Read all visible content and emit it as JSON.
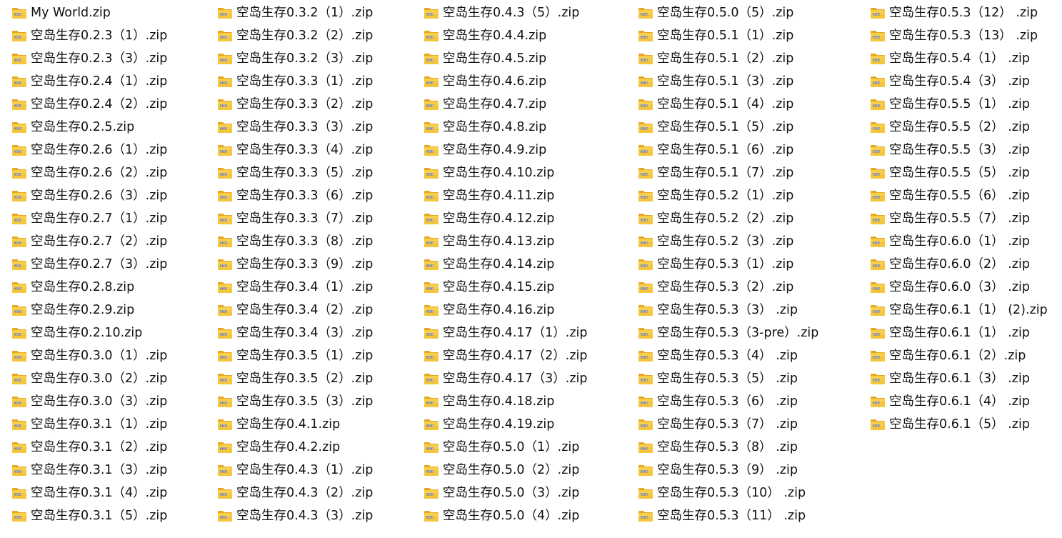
{
  "window": {
    "view": "icons-list",
    "icon": "zip-folder-icon"
  },
  "columns": [
    {
      "id": "col-1",
      "files": [
        "My World.zip",
        "空岛生存0.2.3（1）.zip",
        "空岛生存0.2.3（3）.zip",
        "空岛生存0.2.4（1）.zip",
        "空岛生存0.2.4（2）.zip",
        "空岛生存0.2.5.zip",
        "空岛生存0.2.6（1）.zip",
        "空岛生存0.2.6（2）.zip",
        "空岛生存0.2.6（3）.zip",
        "空岛生存0.2.7（1）.zip",
        "空岛生存0.2.7（2）.zip",
        "空岛生存0.2.7（3）.zip",
        "空岛生存0.2.8.zip",
        "空岛生存0.2.9.zip",
        "空岛生存0.2.10.zip",
        "空岛生存0.3.0（1）.zip",
        "空岛生存0.3.0（2）.zip",
        "空岛生存0.3.0（3）.zip",
        "空岛生存0.3.1（1）.zip",
        "空岛生存0.3.1（2）.zip",
        "空岛生存0.3.1（3）.zip",
        "空岛生存0.3.1（4）.zip",
        "空岛生存0.3.1（5）.zip"
      ]
    },
    {
      "id": "col-2",
      "files": [
        "空岛生存0.3.2（1）.zip",
        "空岛生存0.3.2（2）.zip",
        "空岛生存0.3.2（3）.zip",
        "空岛生存0.3.3（1）.zip",
        "空岛生存0.3.3（2）.zip",
        "空岛生存0.3.3（3）.zip",
        "空岛生存0.3.3（4）.zip",
        "空岛生存0.3.3（5）.zip",
        "空岛生存0.3.3（6）.zip",
        "空岛生存0.3.3（7）.zip",
        "空岛生存0.3.3（8）.zip",
        "空岛生存0.3.3（9）.zip",
        "空岛生存0.3.4（1）.zip",
        "空岛生存0.3.4（2）.zip",
        "空岛生存0.3.4（3）.zip",
        "空岛生存0.3.5（1）.zip",
        "空岛生存0.3.5（2）.zip",
        "空岛生存0.3.5（3）.zip",
        "空岛生存0.4.1.zip",
        "空岛生存0.4.2.zip",
        "空岛生存0.4.3（1）.zip",
        "空岛生存0.4.3（2）.zip",
        "空岛生存0.4.3（3）.zip"
      ]
    },
    {
      "id": "col-3",
      "files": [
        "空岛生存0.4.3（5）.zip",
        "空岛生存0.4.4.zip",
        "空岛生存0.4.5.zip",
        "空岛生存0.4.6.zip",
        "空岛生存0.4.7.zip",
        "空岛生存0.4.8.zip",
        "空岛生存0.4.9.zip",
        "空岛生存0.4.10.zip",
        "空岛生存0.4.11.zip",
        "空岛生存0.4.12.zip",
        "空岛生存0.4.13.zip",
        "空岛生存0.4.14.zip",
        "空岛生存0.4.15.zip",
        "空岛生存0.4.16.zip",
        "空岛生存0.4.17（1）.zip",
        "空岛生存0.4.17（2）.zip",
        "空岛生存0.4.17（3）.zip",
        "空岛生存0.4.18.zip",
        "空岛生存0.4.19.zip",
        "空岛生存0.5.0（1）.zip",
        "空岛生存0.5.0（2）.zip",
        "空岛生存0.5.0（3）.zip",
        "空岛生存0.5.0（4）.zip"
      ]
    },
    {
      "id": "col-4",
      "files": [
        "空岛生存0.5.0（5）.zip",
        "空岛生存0.5.1（1）.zip",
        "空岛生存0.5.1（2）.zip",
        "空岛生存0.5.1（3）.zip",
        "空岛生存0.5.1（4）.zip",
        "空岛生存0.5.1（5）.zip",
        "空岛生存0.5.1（6）.zip",
        "空岛生存0.5.1（7）.zip",
        "空岛生存0.5.2（1）.zip",
        "空岛生存0.5.2（2）.zip",
        "空岛生存0.5.2（3）.zip",
        "空岛生存0.5.3（1）.zip",
        "空岛生存0.5.3（2）.zip",
        "空岛生存0.5.3（3） .zip",
        "空岛生存0.5.3（3-pre）.zip",
        "空岛生存0.5.3（4） .zip",
        "空岛生存0.5.3（5） .zip",
        "空岛生存0.5.3（6） .zip",
        "空岛生存0.5.3（7） .zip",
        "空岛生存0.5.3（8） .zip",
        "空岛生存0.5.3（9） .zip",
        "空岛生存0.5.3（10） .zip",
        "空岛生存0.5.3（11） .zip"
      ]
    },
    {
      "id": "col-5",
      "files": [
        "空岛生存0.5.3（12） .zip",
        "空岛生存0.5.3（13） .zip",
        "空岛生存0.5.4（1） .zip",
        "空岛生存0.5.4（3） .zip",
        "空岛生存0.5.5（1） .zip",
        "空岛生存0.5.5（2） .zip",
        "空岛生存0.5.5（3） .zip",
        "空岛生存0.5.5（5） .zip",
        "空岛生存0.5.5（6） .zip",
        "空岛生存0.5.5（7） .zip",
        "空岛生存0.6.0（1） .zip",
        "空岛生存0.6.0（2） .zip",
        "空岛生存0.6.0（3） .zip",
        "空岛生存0.6.1（1） (2).zip",
        "空岛生存0.6.1（1） .zip",
        "空岛生存0.6.1（2）.zip",
        "空岛生存0.6.1（3） .zip",
        "空岛生存0.6.1（4） .zip",
        "空岛生存0.6.1（5） .zip"
      ]
    }
  ]
}
